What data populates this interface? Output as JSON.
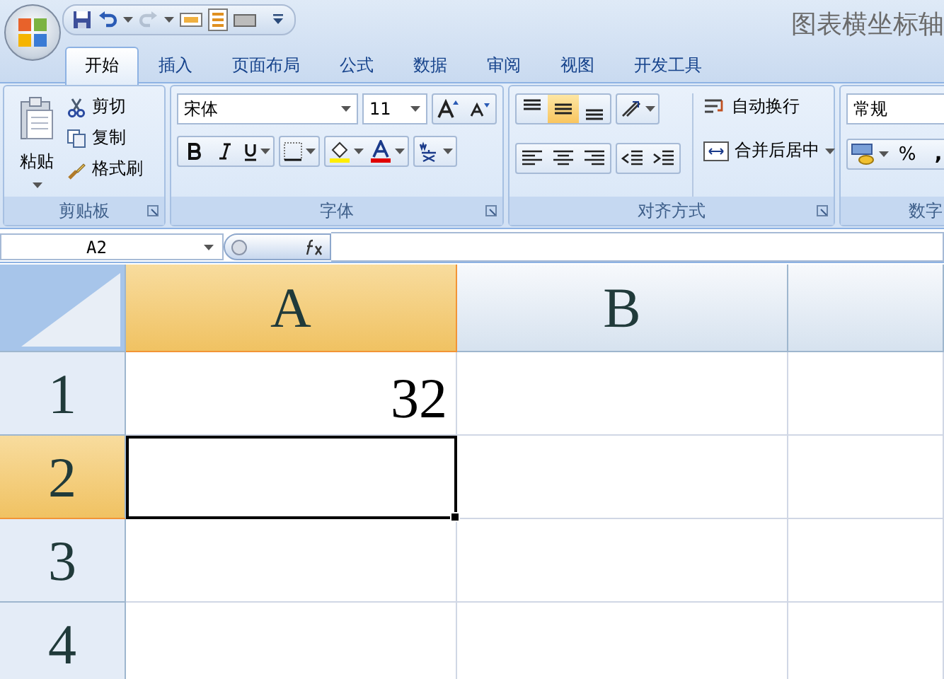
{
  "window": {
    "title": "图表横坐标轴"
  },
  "quick_access": {
    "redo_disabled": true
  },
  "tabs": [
    {
      "label": "开始",
      "selected": true
    },
    {
      "label": "插入",
      "selected": false
    },
    {
      "label": "页面布局",
      "selected": false
    },
    {
      "label": "公式",
      "selected": false
    },
    {
      "label": "数据",
      "selected": false
    },
    {
      "label": "审阅",
      "selected": false
    },
    {
      "label": "视图",
      "selected": false
    },
    {
      "label": "开发工具",
      "selected": false
    }
  ],
  "clipboard": {
    "paste": "粘贴",
    "items": [
      "剪切",
      "复制",
      "格式刷"
    ],
    "title": "剪贴板"
  },
  "font": {
    "name": "宋体",
    "size": "11",
    "title": "字体"
  },
  "alignment": {
    "vertical": [
      {
        "kind": "top",
        "selected": false
      },
      {
        "kind": "middle",
        "selected": true
      },
      {
        "kind": "bottom",
        "selected": false
      }
    ],
    "wrap": "自动换行",
    "merge": "合并后居中",
    "title": "对齐方式"
  },
  "number": {
    "format": "常规",
    "percent": "%",
    "comma": ",",
    "title": "数字"
  },
  "formula_bar": {
    "name_box": "A2"
  },
  "sheet": {
    "columns": [
      {
        "label": "A",
        "selected": true
      },
      {
        "label": "B",
        "selected": false
      }
    ],
    "rows": [
      {
        "label": "1",
        "selected": false,
        "cell_a": "32"
      },
      {
        "label": "2",
        "selected": true
      },
      {
        "label": "3",
        "selected": false
      },
      {
        "label": "4",
        "selected": false
      }
    ]
  }
}
